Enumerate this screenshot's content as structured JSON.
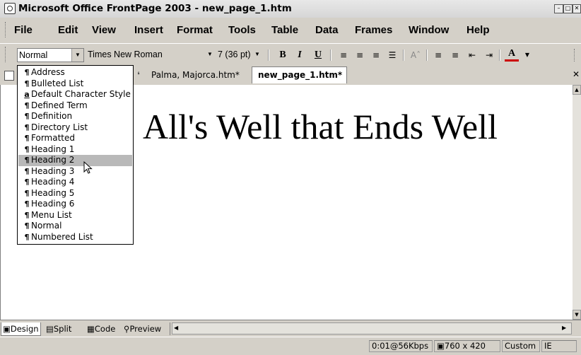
{
  "window": {
    "title": "Microsoft Office FrontPage 2003 - new_page_1.htm"
  },
  "menu": [
    "File",
    "Edit",
    "View",
    "Insert",
    "Format",
    "Tools",
    "Table",
    "Data",
    "Frames",
    "Window",
    "Help"
  ],
  "toolbar": {
    "style_value": "Normal",
    "font_value": "Times New Roman",
    "size_value": "7 (36 pt)",
    "bold_label": "B",
    "italic_label": "I",
    "underline_label": "U",
    "font_color_label": "A"
  },
  "tabs": [
    "Palma, Majorca.htm*",
    "new_page_1.htm*"
  ],
  "style_list": {
    "selected": "Heading 2",
    "items": [
      "Address",
      "Bulleted List",
      "Default Character Style",
      "Defined Term",
      "Definition",
      "Directory List",
      "Formatted",
      "Heading 1",
      "Heading 2",
      "Heading 3",
      "Heading 4",
      "Heading 5",
      "Heading 6",
      "Menu List",
      "Normal",
      "Numbered List"
    ]
  },
  "document": {
    "heading": "All's Well that Ends Well"
  },
  "view_tabs": [
    "Design",
    "Split",
    "Code",
    "Preview"
  ],
  "status": {
    "speed": "0:01@56Kbps",
    "dimensions": "760 x 420",
    "mode": "Custom",
    "browser": "IE"
  },
  "icons": {
    "close_tab": "close-icon",
    "cursor": "arrow-cursor-icon"
  }
}
